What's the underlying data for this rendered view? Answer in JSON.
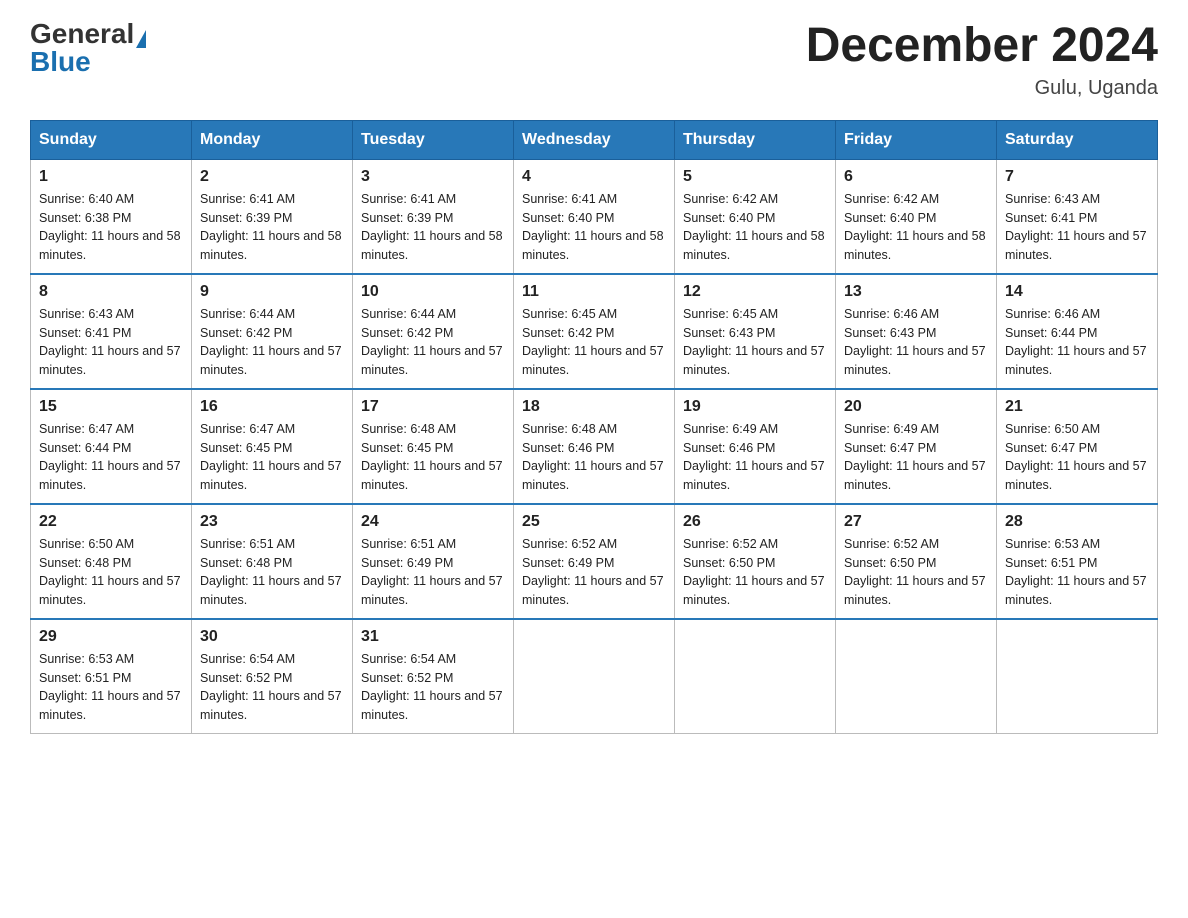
{
  "header": {
    "logo_general": "General",
    "logo_blue": "Blue",
    "month_title": "December 2024",
    "location": "Gulu, Uganda"
  },
  "weekdays": [
    "Sunday",
    "Monday",
    "Tuesday",
    "Wednesday",
    "Thursday",
    "Friday",
    "Saturday"
  ],
  "weeks": [
    [
      {
        "day": "1",
        "sunrise": "6:40 AM",
        "sunset": "6:38 PM",
        "daylight": "11 hours and 58 minutes."
      },
      {
        "day": "2",
        "sunrise": "6:41 AM",
        "sunset": "6:39 PM",
        "daylight": "11 hours and 58 minutes."
      },
      {
        "day": "3",
        "sunrise": "6:41 AM",
        "sunset": "6:39 PM",
        "daylight": "11 hours and 58 minutes."
      },
      {
        "day": "4",
        "sunrise": "6:41 AM",
        "sunset": "6:40 PM",
        "daylight": "11 hours and 58 minutes."
      },
      {
        "day": "5",
        "sunrise": "6:42 AM",
        "sunset": "6:40 PM",
        "daylight": "11 hours and 58 minutes."
      },
      {
        "day": "6",
        "sunrise": "6:42 AM",
        "sunset": "6:40 PM",
        "daylight": "11 hours and 58 minutes."
      },
      {
        "day": "7",
        "sunrise": "6:43 AM",
        "sunset": "6:41 PM",
        "daylight": "11 hours and 57 minutes."
      }
    ],
    [
      {
        "day": "8",
        "sunrise": "6:43 AM",
        "sunset": "6:41 PM",
        "daylight": "11 hours and 57 minutes."
      },
      {
        "day": "9",
        "sunrise": "6:44 AM",
        "sunset": "6:42 PM",
        "daylight": "11 hours and 57 minutes."
      },
      {
        "day": "10",
        "sunrise": "6:44 AM",
        "sunset": "6:42 PM",
        "daylight": "11 hours and 57 minutes."
      },
      {
        "day": "11",
        "sunrise": "6:45 AM",
        "sunset": "6:42 PM",
        "daylight": "11 hours and 57 minutes."
      },
      {
        "day": "12",
        "sunrise": "6:45 AM",
        "sunset": "6:43 PM",
        "daylight": "11 hours and 57 minutes."
      },
      {
        "day": "13",
        "sunrise": "6:46 AM",
        "sunset": "6:43 PM",
        "daylight": "11 hours and 57 minutes."
      },
      {
        "day": "14",
        "sunrise": "6:46 AM",
        "sunset": "6:44 PM",
        "daylight": "11 hours and 57 minutes."
      }
    ],
    [
      {
        "day": "15",
        "sunrise": "6:47 AM",
        "sunset": "6:44 PM",
        "daylight": "11 hours and 57 minutes."
      },
      {
        "day": "16",
        "sunrise": "6:47 AM",
        "sunset": "6:45 PM",
        "daylight": "11 hours and 57 minutes."
      },
      {
        "day": "17",
        "sunrise": "6:48 AM",
        "sunset": "6:45 PM",
        "daylight": "11 hours and 57 minutes."
      },
      {
        "day": "18",
        "sunrise": "6:48 AM",
        "sunset": "6:46 PM",
        "daylight": "11 hours and 57 minutes."
      },
      {
        "day": "19",
        "sunrise": "6:49 AM",
        "sunset": "6:46 PM",
        "daylight": "11 hours and 57 minutes."
      },
      {
        "day": "20",
        "sunrise": "6:49 AM",
        "sunset": "6:47 PM",
        "daylight": "11 hours and 57 minutes."
      },
      {
        "day": "21",
        "sunrise": "6:50 AM",
        "sunset": "6:47 PM",
        "daylight": "11 hours and 57 minutes."
      }
    ],
    [
      {
        "day": "22",
        "sunrise": "6:50 AM",
        "sunset": "6:48 PM",
        "daylight": "11 hours and 57 minutes."
      },
      {
        "day": "23",
        "sunrise": "6:51 AM",
        "sunset": "6:48 PM",
        "daylight": "11 hours and 57 minutes."
      },
      {
        "day": "24",
        "sunrise": "6:51 AM",
        "sunset": "6:49 PM",
        "daylight": "11 hours and 57 minutes."
      },
      {
        "day": "25",
        "sunrise": "6:52 AM",
        "sunset": "6:49 PM",
        "daylight": "11 hours and 57 minutes."
      },
      {
        "day": "26",
        "sunrise": "6:52 AM",
        "sunset": "6:50 PM",
        "daylight": "11 hours and 57 minutes."
      },
      {
        "day": "27",
        "sunrise": "6:52 AM",
        "sunset": "6:50 PM",
        "daylight": "11 hours and 57 minutes."
      },
      {
        "day": "28",
        "sunrise": "6:53 AM",
        "sunset": "6:51 PM",
        "daylight": "11 hours and 57 minutes."
      }
    ],
    [
      {
        "day": "29",
        "sunrise": "6:53 AM",
        "sunset": "6:51 PM",
        "daylight": "11 hours and 57 minutes."
      },
      {
        "day": "30",
        "sunrise": "6:54 AM",
        "sunset": "6:52 PM",
        "daylight": "11 hours and 57 minutes."
      },
      {
        "day": "31",
        "sunrise": "6:54 AM",
        "sunset": "6:52 PM",
        "daylight": "11 hours and 57 minutes."
      },
      null,
      null,
      null,
      null
    ]
  ],
  "labels": {
    "sunrise_prefix": "Sunrise: ",
    "sunset_prefix": "Sunset: ",
    "daylight_prefix": "Daylight: "
  }
}
